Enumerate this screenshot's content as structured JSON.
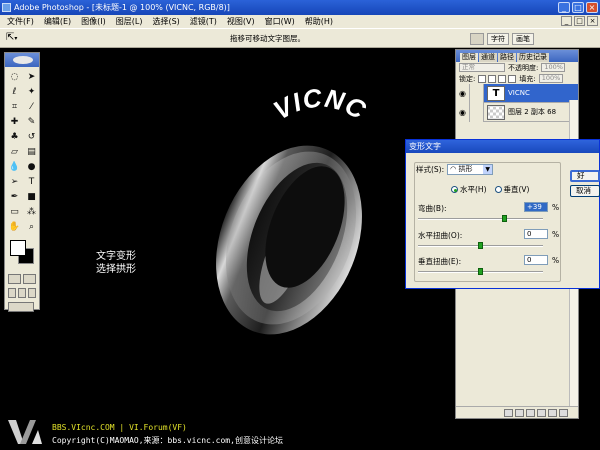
{
  "window": {
    "title": "Adobe Photoshop - [未标题-1 @ 100% (VICNC, RGB/8)]",
    "buttons": [
      "_",
      "□",
      "×"
    ]
  },
  "menu": {
    "items": [
      "文件(F)",
      "编辑(E)",
      "图像(I)",
      "图层(L)",
      "选择(S)",
      "滤镜(T)",
      "视图(V)",
      "窗口(W)",
      "帮助(H)"
    ],
    "doc_buttons": [
      "_",
      "□",
      "×"
    ]
  },
  "options_bar": {
    "hint": "拖移可移动文字图层。",
    "well_tabs": [
      "字符",
      "画笔"
    ]
  },
  "canvas": {
    "note_line1": "文字变形",
    "note_line2": "选择拱形",
    "brand_text": "VICNC"
  },
  "layers_palette": {
    "tabs": [
      "图层",
      "通道",
      "路径",
      "历史记录"
    ],
    "blend_mode": "正常",
    "opacity_label": "不透明度:",
    "opacity_value": "100%",
    "lock_label": "锁定:",
    "fill_label": "填充:",
    "fill_value": "100%",
    "layers": [
      {
        "name": "VICNC",
        "selected": true,
        "thumb": "T"
      },
      {
        "name": "图层 2 副本 68",
        "selected": false,
        "thumb": ""
      }
    ]
  },
  "warp_dialog": {
    "title": "变形文字",
    "style_label": "样式(S):",
    "style_value": "拱形",
    "horizontal_label": "水平(H)",
    "vertical_label": "垂直(V)",
    "orientation": "horizontal",
    "bend_label": "弯曲(B):",
    "bend_value": "+39",
    "hdist_label": "水平扭曲(O):",
    "hdist_value": "0",
    "vdist_label": "垂直扭曲(E):",
    "vdist_value": "0",
    "unit": "%",
    "ok_label": "好",
    "cancel_label": "取消"
  },
  "footer": {
    "line1": "BBS.VIcnc.COM | VI.Forum(VF)",
    "line2": "Copyright(C)MAOMAO,来源：bbs.vicnc.com,创意设计论坛"
  }
}
